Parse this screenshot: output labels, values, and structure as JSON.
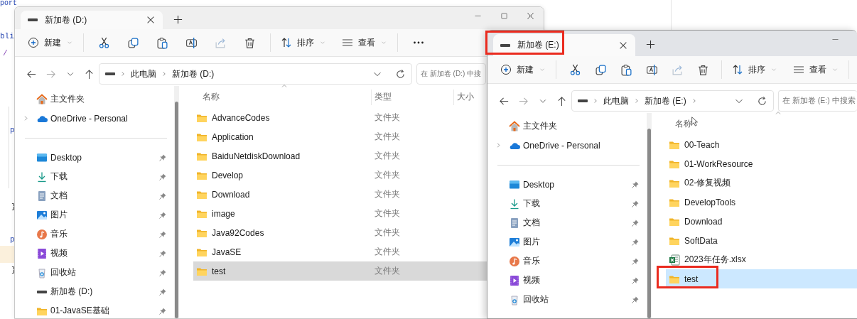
{
  "editor": {
    "lines": [
      {
        "text": "port",
        "kind": "keyword"
      },
      {
        "text": "bli",
        "kind": "keyword"
      },
      {
        "text": "/",
        "kind": "comment"
      },
      {
        "text": "p",
        "kind": "keyword"
      },
      {
        "text": "}",
        "kind": "brace"
      },
      {
        "text": "p",
        "kind": "keyword"
      },
      {
        "text": "}",
        "kind": "brace"
      }
    ]
  },
  "windows": [
    {
      "active": false,
      "tab": {
        "title": "新加卷 (D:)",
        "selected": true,
        "highlighted": false
      },
      "toolbar": {
        "new_label": "新建",
        "sort_label": "排序",
        "view_label": "查看"
      },
      "address": {
        "crumbs": [
          "此电脑",
          "新加卷 (D:)"
        ],
        "trailing_chevron": false
      },
      "search": {
        "placeholder": "在 新加卷 (D:) 中搜"
      },
      "sidebar": {
        "top": [
          {
            "label": "主文件夹",
            "kind": "home"
          },
          {
            "label": "OneDrive - Personal",
            "kind": "cloud",
            "expanded": false
          }
        ],
        "quick": [
          {
            "label": "Desktop",
            "kind": "desktop",
            "pinned": true
          },
          {
            "label": "下载",
            "kind": "download",
            "pinned": true
          },
          {
            "label": "文档",
            "kind": "documents",
            "pinned": true
          },
          {
            "label": "图片",
            "kind": "pictures",
            "pinned": true
          },
          {
            "label": "音乐",
            "kind": "music",
            "pinned": true
          },
          {
            "label": "视频",
            "kind": "videos",
            "pinned": true
          },
          {
            "label": "回收站",
            "kind": "recycle",
            "pinned": true
          },
          {
            "label": "新加卷 (D:)",
            "kind": "drive",
            "pinned": true
          },
          {
            "label": "01-JavaSE基础",
            "kind": "folder",
            "pinned": true
          }
        ]
      },
      "columns": [
        "名称",
        "类型",
        "大小"
      ],
      "files": [
        {
          "name": "AdvanceCodes",
          "type": "文件夹",
          "kind": "folder",
          "selected": false,
          "highlighted": false
        },
        {
          "name": "Application",
          "type": "文件夹",
          "kind": "folder",
          "selected": false,
          "highlighted": false
        },
        {
          "name": "BaiduNetdiskDownload",
          "type": "文件夹",
          "kind": "folder",
          "selected": false,
          "highlighted": false
        },
        {
          "name": "Develop",
          "type": "文件夹",
          "kind": "folder",
          "selected": false,
          "highlighted": false
        },
        {
          "name": "Download",
          "type": "文件夹",
          "kind": "folder",
          "selected": false,
          "highlighted": false
        },
        {
          "name": "image",
          "type": "文件夹",
          "kind": "folder",
          "selected": false,
          "highlighted": false
        },
        {
          "name": "Java92Codes",
          "type": "文件夹",
          "kind": "folder",
          "selected": false,
          "highlighted": false
        },
        {
          "name": "JavaSE",
          "type": "文件夹",
          "kind": "folder",
          "selected": false,
          "highlighted": false
        },
        {
          "name": "test",
          "type": "文件夹",
          "kind": "folder",
          "selected": true,
          "highlighted": false
        }
      ]
    },
    {
      "active": true,
      "tab": {
        "title": "新加卷 (E:)",
        "selected": true,
        "highlighted": true
      },
      "toolbar": {
        "new_label": "新建",
        "sort_label": "排序",
        "view_label": "查看"
      },
      "address": {
        "crumbs": [
          "此电脑",
          "新加卷 (E:)"
        ],
        "trailing_chevron": true
      },
      "search": {
        "placeholder": "在 新加卷 (E:) 中搜索"
      },
      "sidebar": {
        "top": [
          {
            "label": "主文件夹",
            "kind": "home"
          },
          {
            "label": "OneDrive - Personal",
            "kind": "cloud",
            "expanded": false
          }
        ],
        "quick": [
          {
            "label": "Desktop",
            "kind": "desktop",
            "pinned": true
          },
          {
            "label": "下载",
            "kind": "download",
            "pinned": true
          },
          {
            "label": "文档",
            "kind": "documents",
            "pinned": true
          },
          {
            "label": "图片",
            "kind": "pictures",
            "pinned": true
          },
          {
            "label": "音乐",
            "kind": "music",
            "pinned": true
          },
          {
            "label": "视频",
            "kind": "videos",
            "pinned": true
          },
          {
            "label": "回收站",
            "kind": "recycle",
            "pinned": true
          }
        ]
      },
      "columns": [
        "名称"
      ],
      "files": [
        {
          "name": "00-Teach",
          "kind": "folder",
          "selected": false,
          "highlighted": false
        },
        {
          "name": "01-WorkResource",
          "kind": "folder",
          "selected": false,
          "highlighted": false
        },
        {
          "name": "02-修复视频",
          "kind": "folder",
          "selected": false,
          "highlighted": false
        },
        {
          "name": "DevelopTools",
          "kind": "folder",
          "selected": false,
          "highlighted": false
        },
        {
          "name": "Download",
          "kind": "folder",
          "selected": false,
          "highlighted": false
        },
        {
          "name": "SoftData",
          "kind": "folder",
          "selected": false,
          "highlighted": false
        },
        {
          "name": "2023年任务.xlsx",
          "kind": "spreadsheet",
          "selected": false,
          "highlighted": false
        },
        {
          "name": "test",
          "kind": "folder",
          "selected": true,
          "highlighted": true
        }
      ]
    }
  ]
}
